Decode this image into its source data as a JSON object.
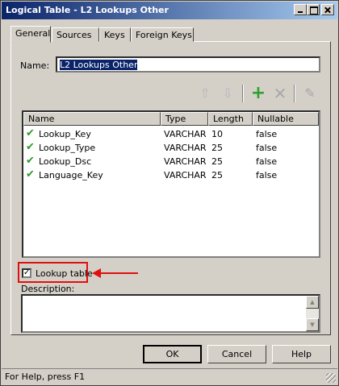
{
  "window": {
    "title": "Logical Table - L2 Lookups Other"
  },
  "tabs": [
    {
      "label": "General"
    },
    {
      "label": "Sources"
    },
    {
      "label": "Keys"
    },
    {
      "label": "Foreign Keys"
    }
  ],
  "name_field": {
    "label": "Name:",
    "value": "L2 Lookups Other"
  },
  "toolbar": {
    "icons": [
      "move-up-icon",
      "move-down-icon",
      "add-icon",
      "delete-icon",
      "edit-icon"
    ]
  },
  "columns": {
    "headers": [
      "Name",
      "Type",
      "Length",
      "Nullable"
    ],
    "rows": [
      {
        "name": "Lookup_Key",
        "type": "VARCHAR",
        "length": "10",
        "nullable": "false"
      },
      {
        "name": "Lookup_Type",
        "type": "VARCHAR",
        "length": "25",
        "nullable": "false"
      },
      {
        "name": "Lookup_Dsc",
        "type": "VARCHAR",
        "length": "25",
        "nullable": "false"
      },
      {
        "name": "Language_Key",
        "type": "VARCHAR",
        "length": "25",
        "nullable": "false"
      }
    ]
  },
  "lookup_table": {
    "label": "Lookup table",
    "checked": true,
    "mark": "✓"
  },
  "description": {
    "label": "Description:",
    "value": ""
  },
  "buttons": {
    "ok": "OK",
    "cancel": "Cancel",
    "help": "Help"
  },
  "status": {
    "text": "For Help, press F1"
  },
  "colors": {
    "titlebar_start": "#0a246a",
    "titlebar_end": "#a6caf0",
    "highlight": "#e01010",
    "check": "#2c9a2c"
  }
}
